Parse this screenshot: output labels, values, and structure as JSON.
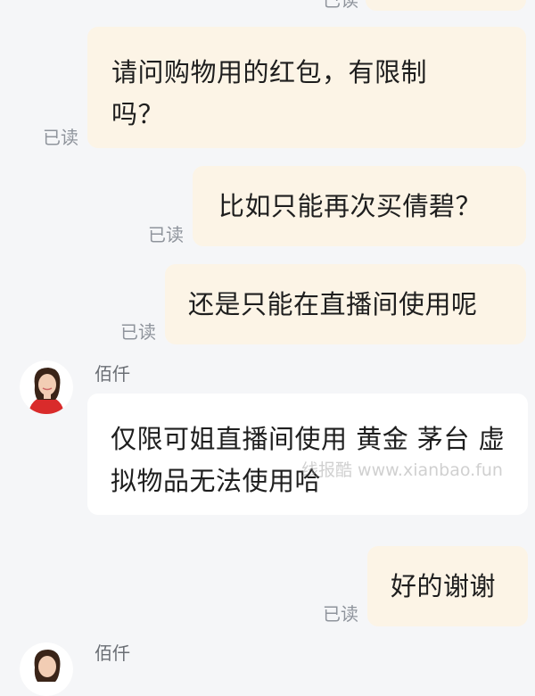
{
  "messages": [
    {
      "from": "self",
      "text": "",
      "read": "已读"
    },
    {
      "from": "self",
      "text": "请问购物用的红包，有限制吗？",
      "read": "已读"
    },
    {
      "from": "self",
      "text": "比如只能再次买倩碧？",
      "read": "已读"
    },
    {
      "from": "self",
      "text": "还是只能在直播间使用呢",
      "read": "已读"
    },
    {
      "from": "other",
      "sender": "佰仟",
      "text": "仅限可姐直播间使用  黄金  茅台  虚拟物品无法使用哈"
    },
    {
      "from": "self",
      "text": "好的谢谢",
      "read": "已读"
    },
    {
      "from": "other",
      "sender": "佰仟",
      "text": ""
    }
  ],
  "watermark": "线报酷 www.xianbao.fun",
  "colors": {
    "background": "#f5f6f8",
    "self_bubble": "#fcf4e6",
    "other_bubble": "#ffffff",
    "read_text": "#8f949c"
  },
  "icons": {
    "avatar": "avatar-woman-red-top"
  }
}
